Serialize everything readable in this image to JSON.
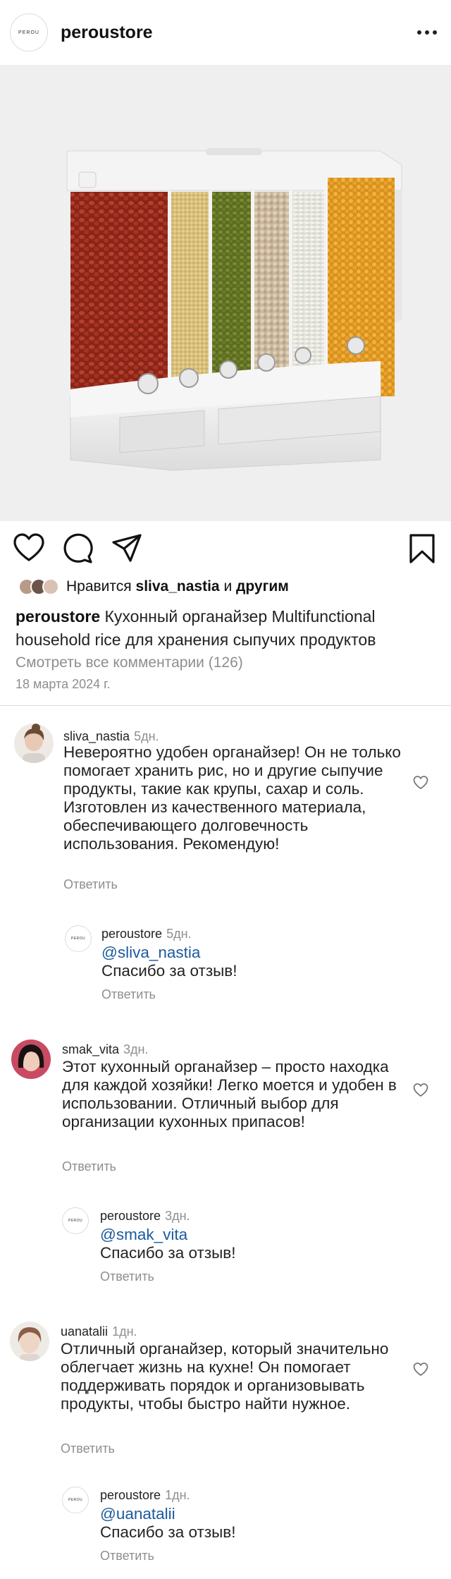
{
  "header": {
    "logo_text": "PEROU",
    "username": "peroustore"
  },
  "post": {
    "likes_prefix": "Нравится",
    "likes_user": "sliva_nastia",
    "likes_and": "и",
    "likes_others": "другим",
    "caption_user": "peroustore",
    "caption_text": "Кухонный органайзер Multifunctional household rice для хранения сыпучих продуктов",
    "view_all_comments": "Смотреть все комментарии (126)",
    "date": "18 марта 2024 г."
  },
  "comments": [
    {
      "user": "sliva_nastia",
      "time": "5дн.",
      "text": "Невероятно удобен органайзер! Он не только помогает хранить рис, но и другие сыпучие продукты, такие как крупы, сахар и соль. Изготовлен из качественного материала, обеспечивающего долговечность использования. Рекомендую!",
      "reply_label": "Ответить",
      "reply": {
        "user": "peroustore",
        "time": "5дн.",
        "mention": "@sliva_nastia",
        "text": "Спасибо за отзыв!",
        "reply_label": "Ответить"
      }
    },
    {
      "user": "smak_vita",
      "time": "3дн.",
      "text": "Этот кухонный органайзер – просто находка для каждой хозяйки! Легко моется и удобен в использовании. Отличный выбор для организации кухонных припасов!",
      "reply_label": "Ответить",
      "reply": {
        "user": "peroustore",
        "time": "3дн.",
        "mention": "@smak_vita",
        "text": "Спасибо за отзыв!",
        "reply_label": "Ответить"
      }
    },
    {
      "user": "uanatalii",
      "time": "1дн.",
      "text": "Отличный органайзер, который значительно облегчает жизнь на кухне! Он помогает поддерживать порядок и организовывать продукты, чтобы быстро найти нужное.",
      "reply_label": "Ответить",
      "reply": {
        "user": "peroustore",
        "time": "1дн.",
        "mention": "@uanatalii",
        "text": "Спасибо за отзыв!",
        "reply_label": "Ответить"
      }
    }
  ],
  "icons": {
    "like": "heart-icon",
    "comment": "comment-icon",
    "share": "send-icon",
    "save": "bookmark-icon",
    "more": "more-icon"
  },
  "colors": {
    "mention": "#1c5a9c",
    "secondary_text": "#8e8e8e"
  }
}
